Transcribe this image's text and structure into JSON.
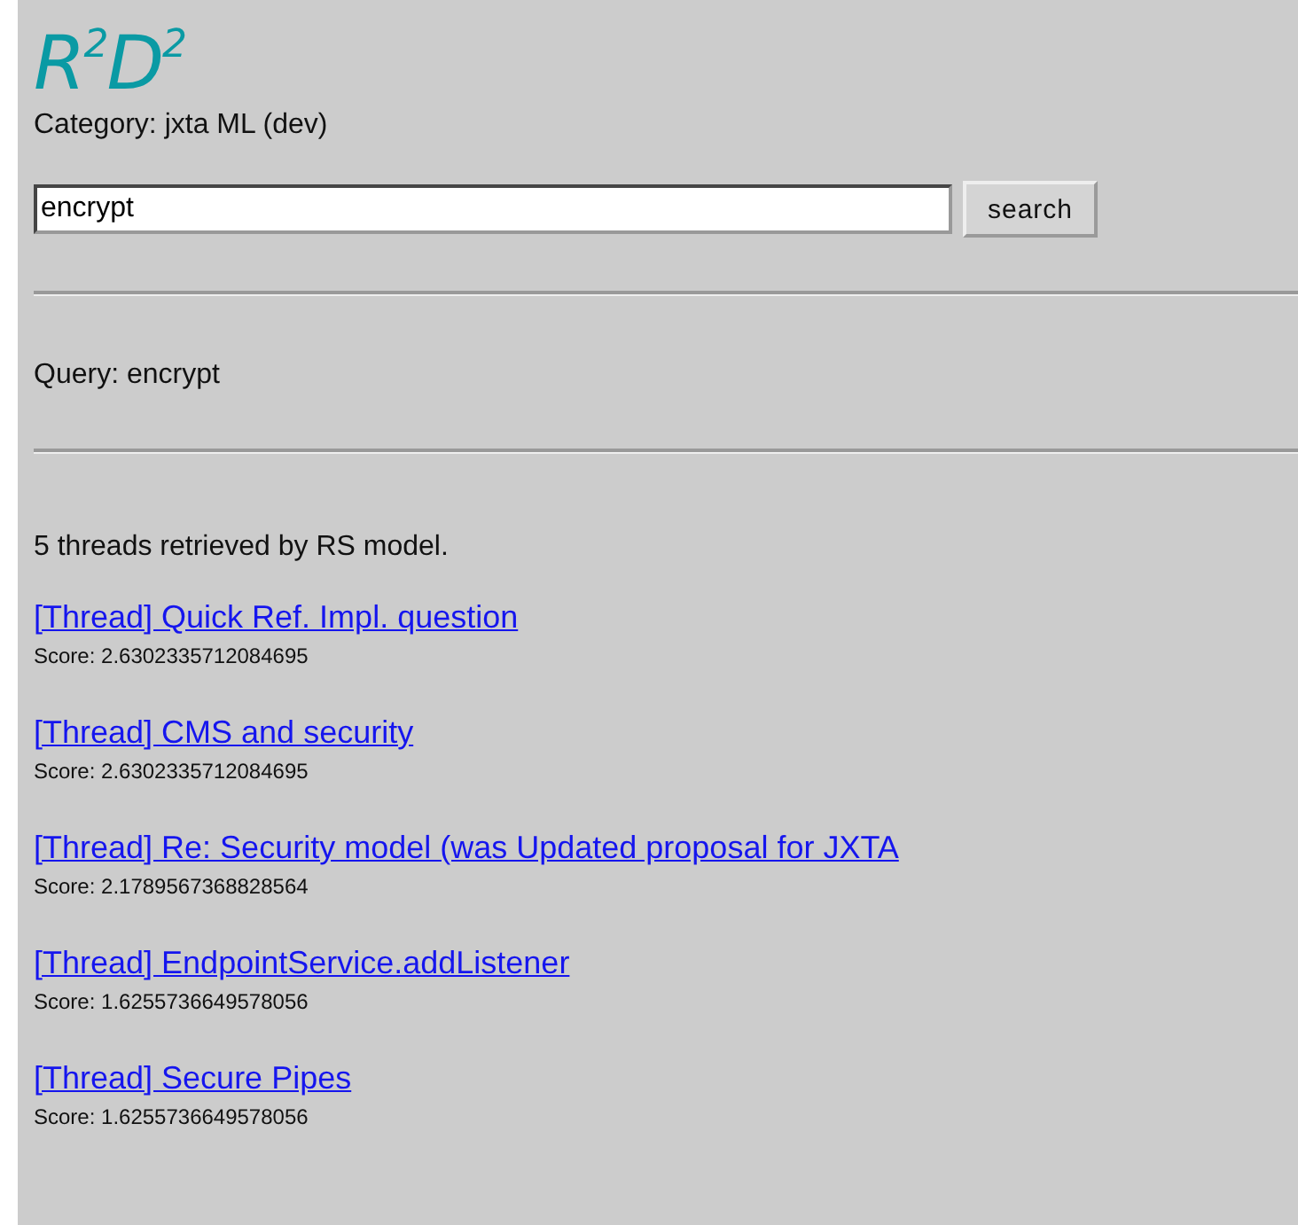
{
  "logo": "R$^{2}$D$^{2}$",
  "category": "Category: jxta ML (dev)",
  "search": {
    "value": "encrypt",
    "button": "search"
  },
  "query": "Query: encrypt",
  "summary": "5 threads retrieved by RS model.",
  "results": [
    {
      "title": "[Thread] Quick Ref. Impl. question",
      "score": "Score: 2.6302335712084695"
    },
    {
      "title": "[Thread] CMS and security",
      "score": "Score: 2.6302335712084695"
    },
    {
      "title": "[Thread] Re: Security model (was Updated proposal for JXTA",
      "score": "Score: 2.1789567368828564"
    },
    {
      "title": "[Thread] EndpointService.addListener",
      "score": "Score: 1.6255736649578056"
    },
    {
      "title": "[Thread] Secure Pipes",
      "score": "Score: 1.6255736649578056"
    }
  ]
}
